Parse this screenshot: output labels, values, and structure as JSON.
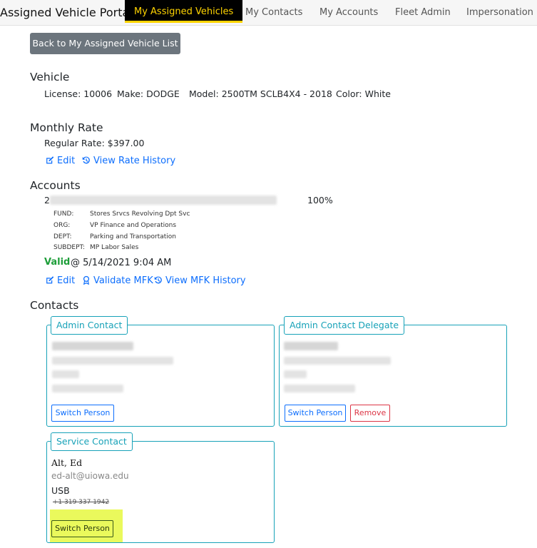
{
  "app": {
    "title": "Assigned Vehicle Portal"
  },
  "nav": {
    "tabs": [
      {
        "label": "My Assigned Vehicles",
        "active": true
      },
      {
        "label": "My Contacts"
      },
      {
        "label": "My Accounts"
      },
      {
        "label": "Fleet Admin"
      },
      {
        "label": "Impersonation"
      }
    ]
  },
  "back_button": "Back to My Assigned Vehicle List",
  "vehicle": {
    "heading": "Vehicle",
    "license": "License: 10006",
    "make": "Make: DODGE",
    "model": "Model: 2500TM SCLB4X4 - 2018",
    "color": "Color: White"
  },
  "monthly_rate": {
    "heading": "Monthly Rate",
    "regular_rate": "Regular Rate: $397.00",
    "edit": "Edit",
    "view_history": "View Rate History"
  },
  "accounts": {
    "heading": "Accounts",
    "row_prefix": "2",
    "percent": "100%",
    "details": [
      {
        "key": "FUND:",
        "value": "Stores Srvcs Revolving Dpt Svc"
      },
      {
        "key": "ORG:",
        "value": "VP Finance and Operations"
      },
      {
        "key": "DEPT:",
        "value": "Parking and Transportation"
      },
      {
        "key": "SUBDEPT:",
        "value": "MP Labor Sales"
      }
    ],
    "status": "Valid",
    "status_time": "@ 5/14/2021 9:04 AM",
    "edit": "Edit",
    "validate": "Validate MFK",
    "view_history": "View MFK History"
  },
  "contacts": {
    "heading": "Contacts",
    "admin_contact": {
      "legend": "Admin Contact",
      "switch": "Switch Person"
    },
    "admin_delegate": {
      "legend": "Admin Contact Delegate",
      "switch": "Switch Person",
      "remove": "Remove"
    },
    "service_contact": {
      "legend": "Service Contact",
      "name": "Alt, Ed",
      "email": "ed-alt@uiowa.edu",
      "dept": "USB",
      "phone": "+1 319 337 1942",
      "switch": "Switch Person"
    }
  },
  "colors": {
    "accent": "#0d6efd",
    "teal": "#17a2b8",
    "valid": "#1e9e3a",
    "danger": "#dc3545",
    "highlight": "#eaf95c",
    "nav_active_text": "#ffd400"
  }
}
